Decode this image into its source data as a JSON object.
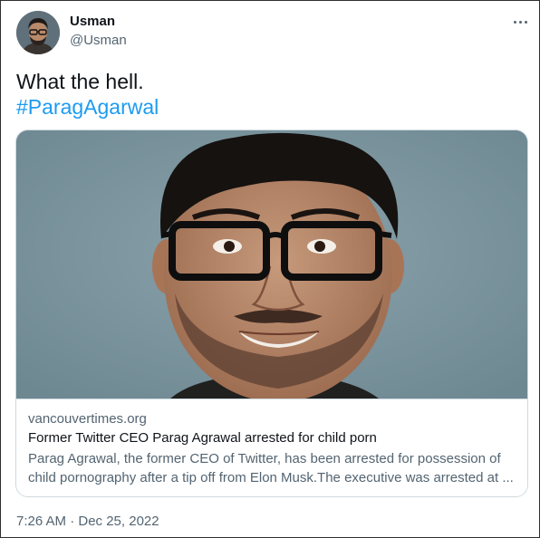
{
  "author": {
    "name": "Usman",
    "handle": "@Usman"
  },
  "tweet": {
    "text": "What the hell.",
    "hashtag": "#ParagAgarwal",
    "timestamp": "7:26 AM · Dec 25, 2022"
  },
  "card": {
    "domain": "vancouvertimes.org",
    "title": "Former Twitter CEO Parag Agrawal arrested for child porn",
    "description_line1": "Parag Agrawal, the former CEO of Twitter, has been arrested for possession of",
    "description_line2": "child pornography after a tip off from Elon Musk.The executive was arrested at ..."
  },
  "icons": {
    "more": "more-horizontal-icon"
  },
  "colors": {
    "link": "#1d9bf0",
    "secondary_text": "#536471",
    "primary_text": "#0f1419",
    "card_border": "#cfd9de",
    "image_background": "#7f98a1"
  }
}
